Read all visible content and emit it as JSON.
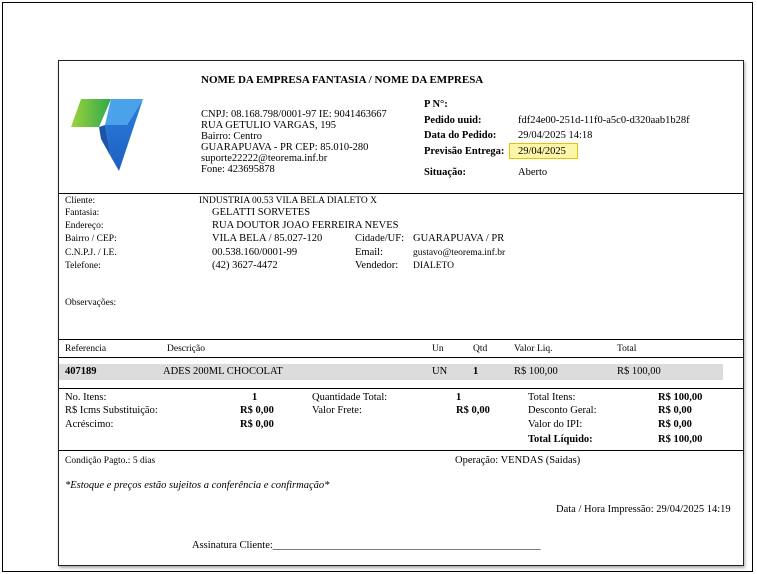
{
  "company": {
    "name": "NOME DA EMPRESA FANTASIA / NOME DA EMPRESA",
    "cnpj_ie": "CNPJ: 08.168.798/0001-97 IE: 9041463667",
    "street": "RUA GETULIO VARGAS, 195",
    "district": "Bairro: Centro",
    "city_cep": "GUARAPUAVA - PR CEP: 85.010-280",
    "email": "suporte22222@teorema.inf.br",
    "phone": "Fone: 423695878"
  },
  "order": {
    "number_label": "P N°:",
    "uuid_label": "Pedido uuid:",
    "uuid": "fdf24e00-251d-11f0-a5c0-d320aab1b28f",
    "date_label": "Data do Pedido:",
    "date": "29/04/2025 14:18",
    "forecast_label": "Previsão Entrega:",
    "forecast": "29/04/2025",
    "status_label": "Situação:",
    "status": "Aberto"
  },
  "client": {
    "labels": {
      "client": "Cliente:",
      "fantasy": "Fantasia:",
      "address": "Endereço:",
      "district_cep": "Bairro / CEP:",
      "cnpj_ie": "C.N.P.J. / I.E.",
      "phone": "Telefone:",
      "city": "Cidade/UF:",
      "email": "Email:",
      "seller": "Vendedor:",
      "notes": "Observações:"
    },
    "name": "INDUSTRIA 00.53 VILA BELA DIALETO X",
    "fantasy": "GELATTI SORVETES",
    "address": "RUA DOUTOR JOAO FERREIRA NEVES",
    "district_cep": "VILA BELA / 85.027-120",
    "cnpj_ie": "00.538.160/0001-99",
    "phone": "(42) 3627-4472",
    "city": "GUARAPUAVA / PR",
    "email": "gustavo@teorema.inf.br",
    "seller": "DIALETO"
  },
  "items": {
    "headers": {
      "ref": "Referencia",
      "desc": "Descrição",
      "unit": "Un",
      "qty": "Qtd",
      "price": "Valor Liq.",
      "total": "Total"
    },
    "rows": [
      {
        "ref": "407189",
        "desc": "ADES 200ML CHOCOLAT",
        "unit": "UN",
        "qty": "1",
        "price": "R$ 100,00",
        "total": "R$ 100,00"
      }
    ]
  },
  "totals": {
    "num_items_label": "No. Itens:",
    "num_items": "1",
    "icms_label": "R$ Icms Substituição:",
    "icms": "R$ 0,00",
    "addition_label": "Acréscimo:",
    "addition": "R$ 0,00",
    "qty_total_label": "Quantidade Total:",
    "qty_total": "1",
    "freight_label": "Valor Frete:",
    "freight": "R$ 0,00",
    "total_items_label": "Total Itens:",
    "total_items": "R$ 100,00",
    "discount_label": "Desconto Geral:",
    "discount": "R$ 0,00",
    "ipi_label": "Valor do IPI:",
    "ipi": "R$ 0,00",
    "net_total_label": "Total Líquido:",
    "net_total": "R$ 100,00"
  },
  "footer": {
    "payment": "Condição Pagto.: 5 dias",
    "operation": "Operação: VENDAS (Saidas)",
    "disclaimer": "*Estoque e preços estão sujeitos a conferência e confirmação*",
    "print_datetime": "Data / Hora Impressão: 29/04/2025 14:19",
    "signature": "Assinatura Cliente:___________________________________________________"
  },
  "colors": {
    "logo_green": "#7dc02e",
    "logo_blue": "#1f6fd1",
    "logo_light_blue": "#4aa3ea",
    "highlight": "#fdf6a8",
    "item_row_bg": "#dcdcdc"
  }
}
